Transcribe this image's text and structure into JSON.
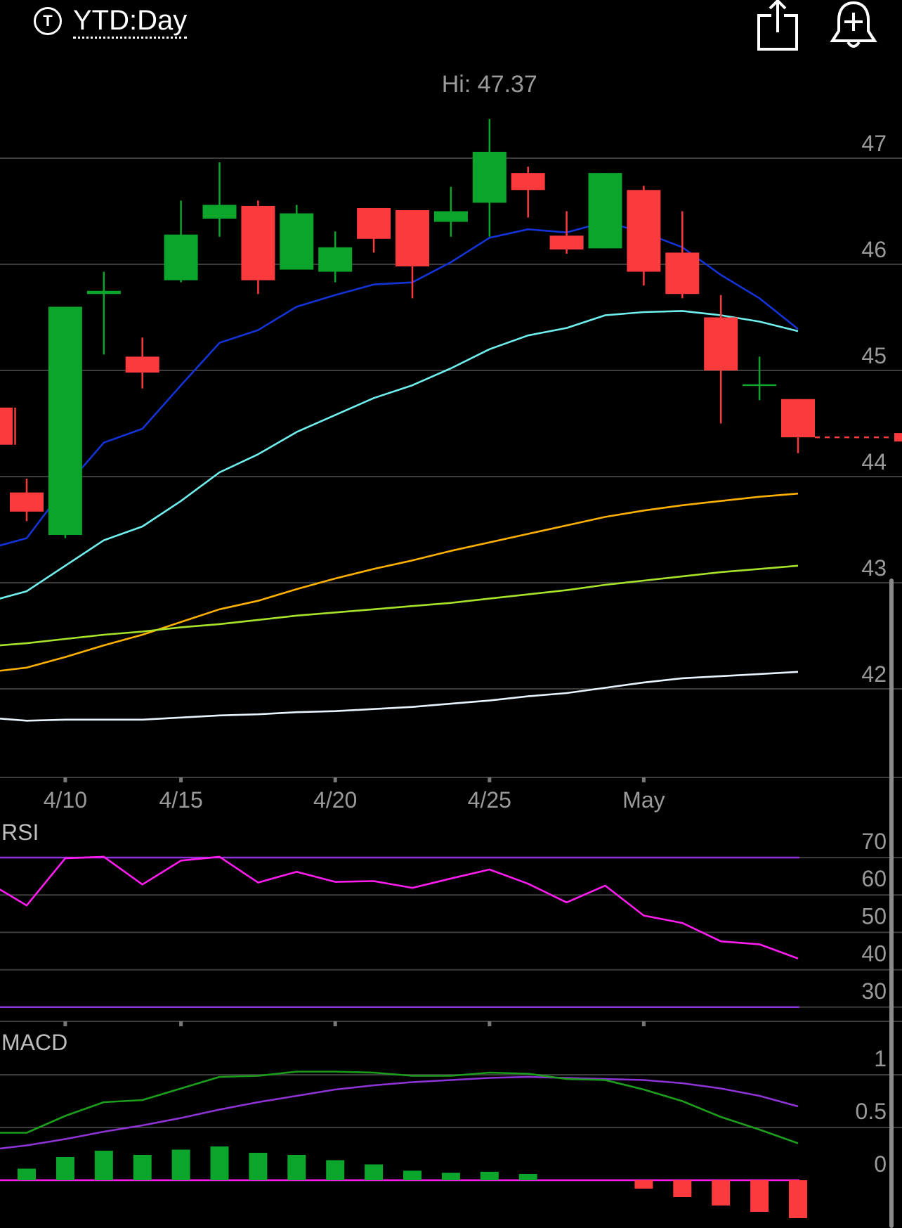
{
  "header": {
    "range_icon_letter": "T",
    "range_label": "YTD:Day",
    "share_icon": "share-icon",
    "alert_icon": "add-alert-bell-icon"
  },
  "colors": {
    "up": "#0ca52c",
    "down": "#fb3a3e",
    "grid": "#3c3c3c",
    "sma_blue": "#1433d6",
    "sma_cyan": "#6ff0ef",
    "sma_orange": "#ffb000",
    "sma_lime": "#a8e22a",
    "sma_white": "#e8f4ff",
    "rsi_line": "#ff1cf0",
    "rsi_bounds": "#8e34d6",
    "macd_line": "#1c9e1c",
    "macd_signal": "#8e34d6",
    "hist_pos": "#0ca52c",
    "hist_neg": "#fb3a3e",
    "zero_line": "#ff1cf0"
  },
  "chart_data": {
    "type": "candlestick",
    "high_label": "Hi: 47.37",
    "y_ticks": [
      47,
      46,
      45,
      44,
      43,
      42
    ],
    "ylim": [
      41.15,
      47.5
    ],
    "x_ticks": [
      {
        "label": "4/10",
        "x": 1
      },
      {
        "label": "4/15",
        "x": 4
      },
      {
        "label": "4/20",
        "x": 8
      },
      {
        "label": "4/25",
        "x": 12
      },
      {
        "label": "May",
        "x": 16
      }
    ],
    "x_range": [
      -0.7,
      22.6
    ],
    "last_price": 44.37,
    "candles": [
      {
        "x": -0.3,
        "o": 44.65,
        "h": 44.65,
        "l": 44.3,
        "c": 44.3
      },
      {
        "x": 0,
        "o": 43.85,
        "h": 43.98,
        "l": 43.58,
        "c": 43.67
      },
      {
        "x": 1,
        "o": 43.45,
        "h": 43.7,
        "l": 43.42,
        "c": 45.6
      },
      {
        "x": 2,
        "o": 45.72,
        "h": 45.93,
        "l": 45.15,
        "c": 45.75
      },
      {
        "x": 3,
        "o": 45.13,
        "h": 45.31,
        "l": 44.83,
        "c": 44.98
      },
      {
        "x": 4,
        "o": 45.85,
        "h": 46.6,
        "l": 45.83,
        "c": 46.28
      },
      {
        "x": 5,
        "o": 46.43,
        "h": 46.96,
        "l": 46.26,
        "c": 46.56
      },
      {
        "x": 6,
        "o": 46.55,
        "h": 46.6,
        "l": 45.72,
        "c": 45.85
      },
      {
        "x": 7,
        "o": 45.95,
        "h": 46.56,
        "l": 45.95,
        "c": 46.48
      },
      {
        "x": 8,
        "o": 45.93,
        "h": 46.31,
        "l": 45.83,
        "c": 46.16
      },
      {
        "x": 9,
        "o": 46.53,
        "h": 46.53,
        "l": 46.11,
        "c": 46.24
      },
      {
        "x": 10,
        "o": 46.51,
        "h": 46.51,
        "l": 45.68,
        "c": 45.98
      },
      {
        "x": 11,
        "o": 46.4,
        "h": 46.73,
        "l": 46.26,
        "c": 46.5
      },
      {
        "x": 12,
        "o": 46.58,
        "h": 47.37,
        "l": 46.26,
        "c": 47.06
      },
      {
        "x": 13,
        "o": 46.86,
        "h": 46.92,
        "l": 46.44,
        "c": 46.7
      },
      {
        "x": 14,
        "o": 46.27,
        "h": 46.5,
        "l": 46.1,
        "c": 46.14
      },
      {
        "x": 15,
        "o": 46.15,
        "h": 46.86,
        "l": 46.15,
        "c": 46.86
      },
      {
        "x": 16,
        "o": 46.7,
        "h": 46.74,
        "l": 45.8,
        "c": 45.93
      },
      {
        "x": 17,
        "o": 46.11,
        "h": 46.5,
        "l": 45.68,
        "c": 45.72
      },
      {
        "x": 18,
        "o": 45.5,
        "h": 45.71,
        "l": 44.5,
        "c": 45.0
      },
      {
        "x": 19,
        "o": 44.87,
        "h": 45.13,
        "l": 44.72,
        "c": 44.87
      },
      {
        "x": 20,
        "o": 44.73,
        "h": 44.73,
        "l": 44.22,
        "c": 44.37
      }
    ],
    "moving_averages": [
      {
        "color_key": "sma_blue",
        "points": [
          [
            -0.7,
            43.35
          ],
          [
            0,
            43.42
          ],
          [
            1,
            43.9
          ],
          [
            2,
            44.32
          ],
          [
            3,
            44.45
          ],
          [
            4,
            44.86
          ],
          [
            5,
            45.26
          ],
          [
            6,
            45.38
          ],
          [
            7,
            45.6
          ],
          [
            8,
            45.71
          ],
          [
            9,
            45.81
          ],
          [
            10,
            45.83
          ],
          [
            11,
            46.02
          ],
          [
            12,
            46.25
          ],
          [
            13,
            46.33
          ],
          [
            14,
            46.3
          ],
          [
            15,
            46.4
          ],
          [
            16,
            46.3
          ],
          [
            17,
            46.16
          ],
          [
            18,
            45.9
          ],
          [
            19,
            45.68
          ],
          [
            20,
            45.39
          ]
        ]
      },
      {
        "color_key": "sma_cyan",
        "points": [
          [
            -0.7,
            42.85
          ],
          [
            0,
            42.92
          ],
          [
            1,
            43.16
          ],
          [
            2,
            43.4
          ],
          [
            3,
            43.53
          ],
          [
            4,
            43.77
          ],
          [
            5,
            44.04
          ],
          [
            6,
            44.21
          ],
          [
            7,
            44.42
          ],
          [
            8,
            44.58
          ],
          [
            9,
            44.74
          ],
          [
            10,
            44.86
          ],
          [
            11,
            45.02
          ],
          [
            12,
            45.2
          ],
          [
            13,
            45.33
          ],
          [
            14,
            45.4
          ],
          [
            15,
            45.52
          ],
          [
            16,
            45.55
          ],
          [
            17,
            45.56
          ],
          [
            18,
            45.52
          ],
          [
            19,
            45.46
          ],
          [
            20,
            45.37
          ]
        ]
      },
      {
        "color_key": "sma_orange",
        "points": [
          [
            -0.7,
            42.17
          ],
          [
            0,
            42.2
          ],
          [
            1,
            42.3
          ],
          [
            2,
            42.41
          ],
          [
            3,
            42.51
          ],
          [
            4,
            42.63
          ],
          [
            5,
            42.75
          ],
          [
            6,
            42.83
          ],
          [
            7,
            42.94
          ],
          [
            8,
            43.04
          ],
          [
            9,
            43.13
          ],
          [
            10,
            43.21
          ],
          [
            11,
            43.3
          ],
          [
            12,
            43.38
          ],
          [
            13,
            43.46
          ],
          [
            14,
            43.54
          ],
          [
            15,
            43.62
          ],
          [
            16,
            43.68
          ],
          [
            17,
            43.73
          ],
          [
            18,
            43.77
          ],
          [
            19,
            43.81
          ],
          [
            20,
            43.84
          ]
        ]
      },
      {
        "color_key": "sma_lime",
        "points": [
          [
            -0.7,
            42.41
          ],
          [
            0,
            42.43
          ],
          [
            1,
            42.47
          ],
          [
            2,
            42.51
          ],
          [
            3,
            42.54
          ],
          [
            4,
            42.58
          ],
          [
            5,
            42.61
          ],
          [
            6,
            42.65
          ],
          [
            7,
            42.69
          ],
          [
            8,
            42.72
          ],
          [
            9,
            42.75
          ],
          [
            10,
            42.78
          ],
          [
            11,
            42.81
          ],
          [
            12,
            42.85
          ],
          [
            13,
            42.89
          ],
          [
            14,
            42.93
          ],
          [
            15,
            42.98
          ],
          [
            16,
            43.02
          ],
          [
            17,
            43.06
          ],
          [
            18,
            43.1
          ],
          [
            19,
            43.13
          ],
          [
            20,
            43.16
          ]
        ]
      },
      {
        "color_key": "sma_white",
        "points": [
          [
            -0.7,
            41.72
          ],
          [
            0,
            41.7
          ],
          [
            1,
            41.71
          ],
          [
            2,
            41.71
          ],
          [
            3,
            41.71
          ],
          [
            4,
            41.73
          ],
          [
            5,
            41.75
          ],
          [
            6,
            41.76
          ],
          [
            7,
            41.78
          ],
          [
            8,
            41.79
          ],
          [
            9,
            41.81
          ],
          [
            10,
            41.83
          ],
          [
            11,
            41.86
          ],
          [
            12,
            41.89
          ],
          [
            13,
            41.93
          ],
          [
            14,
            41.96
          ],
          [
            15,
            42.01
          ],
          [
            16,
            42.06
          ],
          [
            17,
            42.1
          ],
          [
            18,
            42.12
          ],
          [
            19,
            42.14
          ],
          [
            20,
            42.16
          ]
        ]
      }
    ],
    "rsi": {
      "label": "RSI",
      "y_ticks": [
        70,
        60,
        50,
        40,
        30
      ],
      "ylim": [
        24.5,
        75.5
      ],
      "overbought": 70,
      "oversold": 30,
      "points": [
        [
          -0.7,
          61.5
        ],
        [
          0,
          57.2
        ],
        [
          1,
          69.8
        ],
        [
          2,
          70.2
        ],
        [
          3,
          62.8
        ],
        [
          4,
          69.2
        ],
        [
          5,
          70.2
        ],
        [
          6,
          63.3
        ],
        [
          7,
          66.2
        ],
        [
          8,
          63.5
        ],
        [
          9,
          63.7
        ],
        [
          10,
          61.9
        ],
        [
          11,
          64.4
        ],
        [
          12,
          66.8
        ],
        [
          13,
          63.0
        ],
        [
          14,
          58.0
        ],
        [
          15,
          62.5
        ],
        [
          16,
          54.5
        ],
        [
          17,
          52.5
        ],
        [
          18,
          47.6
        ],
        [
          19,
          46.8
        ],
        [
          20,
          43.0
        ]
      ]
    },
    "macd": {
      "label": "MACD",
      "y_ticks": [
        "1",
        "0.5",
        "0"
      ],
      "ylim": [
        -0.38,
        1.3
      ],
      "macd_points": [
        [
          -0.7,
          0.45
        ],
        [
          0,
          0.45
        ],
        [
          1,
          0.61
        ],
        [
          2,
          0.74
        ],
        [
          3,
          0.76
        ],
        [
          4,
          0.87
        ],
        [
          5,
          0.98
        ],
        [
          6,
          0.99
        ],
        [
          7,
          1.03
        ],
        [
          8,
          1.03
        ],
        [
          9,
          1.02
        ],
        [
          10,
          0.99
        ],
        [
          11,
          0.99
        ],
        [
          12,
          1.02
        ],
        [
          13,
          1.01
        ],
        [
          14,
          0.96
        ],
        [
          15,
          0.95
        ],
        [
          16,
          0.86
        ],
        [
          17,
          0.75
        ],
        [
          18,
          0.6
        ],
        [
          19,
          0.48
        ],
        [
          20,
          0.35
        ]
      ],
      "signal_points": [
        [
          -0.7,
          0.3
        ],
        [
          0,
          0.33
        ],
        [
          1,
          0.39
        ],
        [
          2,
          0.46
        ],
        [
          3,
          0.52
        ],
        [
          4,
          0.59
        ],
        [
          5,
          0.67
        ],
        [
          6,
          0.74
        ],
        [
          7,
          0.8
        ],
        [
          8,
          0.86
        ],
        [
          9,
          0.9
        ],
        [
          10,
          0.93
        ],
        [
          11,
          0.95
        ],
        [
          12,
          0.97
        ],
        [
          13,
          0.98
        ],
        [
          14,
          0.97
        ],
        [
          15,
          0.96
        ],
        [
          16,
          0.95
        ],
        [
          17,
          0.92
        ],
        [
          18,
          0.87
        ],
        [
          19,
          0.8
        ],
        [
          20,
          0.7
        ]
      ],
      "histogram": [
        [
          0,
          0.11
        ],
        [
          1,
          0.22
        ],
        [
          2,
          0.28
        ],
        [
          3,
          0.24
        ],
        [
          4,
          0.29
        ],
        [
          5,
          0.32
        ],
        [
          6,
          0.26
        ],
        [
          7,
          0.24
        ],
        [
          8,
          0.19
        ],
        [
          9,
          0.15
        ],
        [
          10,
          0.09
        ],
        [
          11,
          0.07
        ],
        [
          12,
          0.08
        ],
        [
          13,
          0.06
        ],
        [
          16,
          -0.08
        ],
        [
          17,
          -0.16
        ],
        [
          18,
          -0.24
        ],
        [
          19,
          -0.3
        ],
        [
          20,
          -0.36
        ]
      ]
    }
  }
}
